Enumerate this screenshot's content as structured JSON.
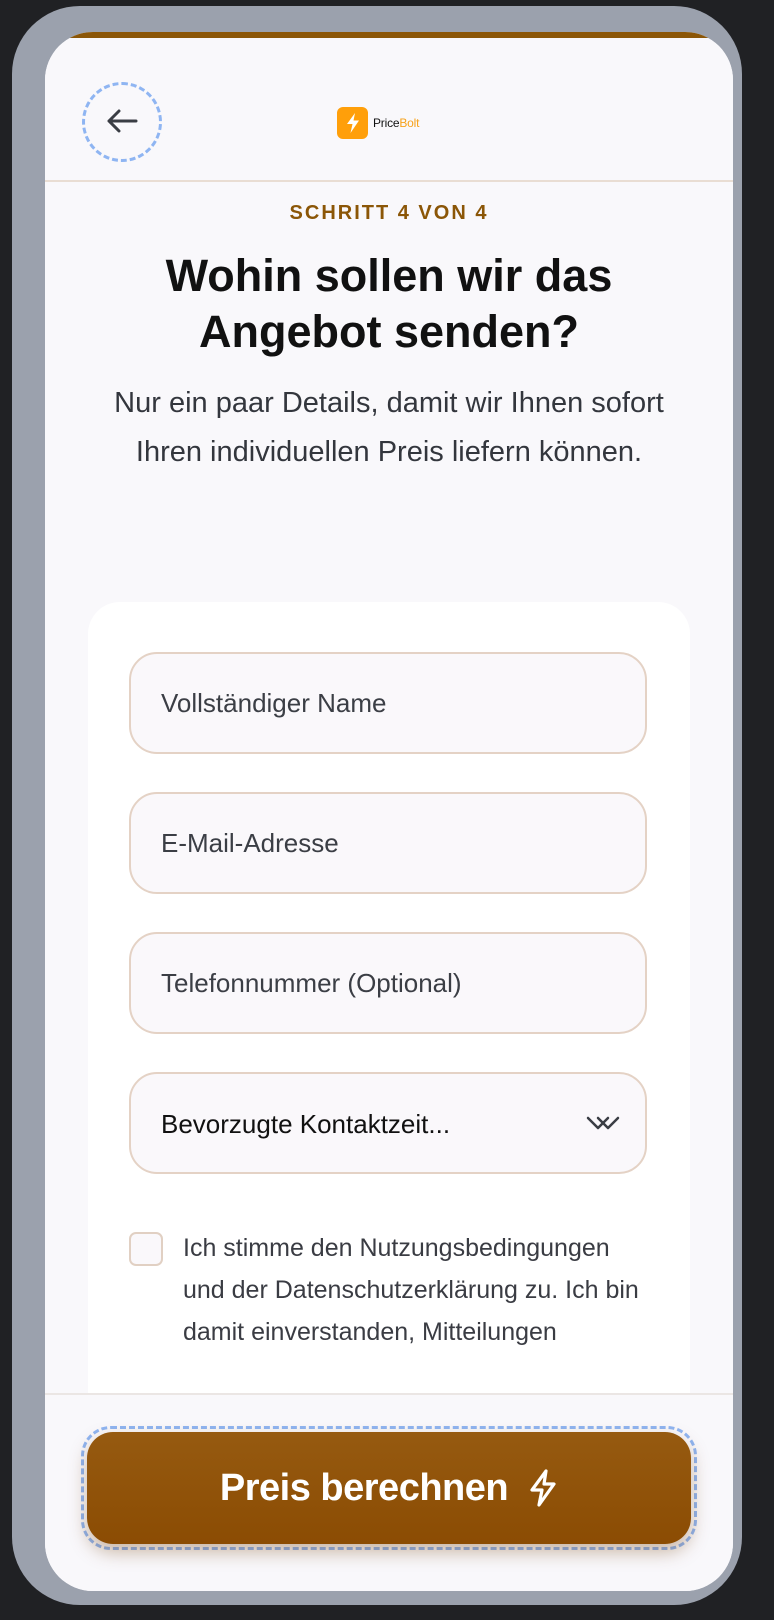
{
  "header": {
    "brand_prefix": "Price",
    "brand_suffix": "Bolt"
  },
  "step": {
    "label": "SCHRITT 4 VON 4"
  },
  "main": {
    "title": "Wohin sollen wir das Angebot senden?",
    "subtitle": "Nur ein paar Details, damit wir Ihnen sofort Ihren individuellen Preis liefern können."
  },
  "form": {
    "name_placeholder": "Vollständiger Name",
    "email_placeholder": "E-Mail-Adresse",
    "phone_placeholder": "Telefonnummer (Optional)",
    "contact_time_value": "Bevorzugte Kontaktzeit...",
    "consent_text": "Ich stimme den Nutzungsbedingungen und der Datenschutzerklärung zu. Ich bin damit einverstanden, Mitteilungen"
  },
  "cta": {
    "label": "Preis berechnen"
  },
  "icons": {
    "back": "arrow-left-icon",
    "logo": "lightning-bolt-icon",
    "dropdown": "chevron-down-icon",
    "cta": "lightning-bolt-icon"
  },
  "colors": {
    "accent": "#8b5607",
    "logo": "#ff9f0a",
    "focus_outline": "#8fb5f2"
  }
}
